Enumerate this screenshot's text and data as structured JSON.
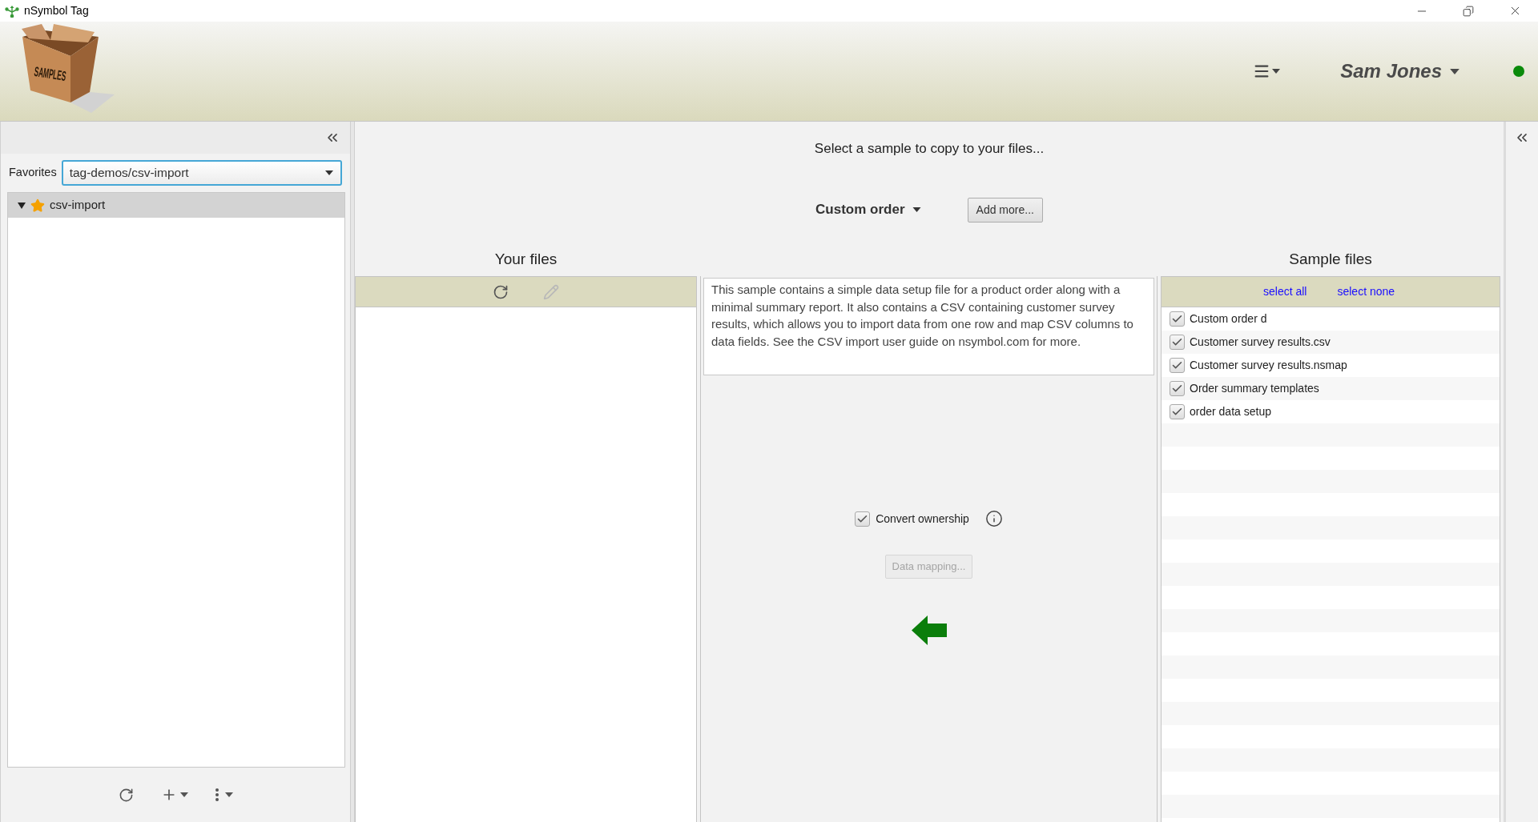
{
  "window": {
    "title": "nSymbol Tag"
  },
  "header": {
    "logo_text": "SAMPLES",
    "user": {
      "name": "Sam Jones",
      "online": true
    }
  },
  "left_panel": {
    "favorites": {
      "label": "Favorites",
      "value": "tag-demos/csv-import",
      "focused": true
    },
    "tree": [
      {
        "label": "csv-import",
        "expanded": true,
        "favorite": true,
        "selected": true
      }
    ]
  },
  "main": {
    "prompt": "Select a sample to copy to your files...",
    "sample_choice": "Custom order",
    "add_button": "Add more...",
    "your_files": {
      "heading": "Your files",
      "tools": [
        {
          "kind": "refresh",
          "disabled": false
        },
        {
          "kind": "edit",
          "disabled": true
        }
      ]
    },
    "description": "This sample contains a simple data setup file for a product order along with a minimal summary report. It also contains a CSV containing customer survey results, which allows you to import data from one row and map CSV columns to data fields. See the CSV import user guide on nsymbol.com for more.",
    "convert_ownership": {
      "label": "Convert ownership",
      "checked": true
    },
    "data_mapping": {
      "label": "Data mapping...",
      "disabled": true
    },
    "sample_files": {
      "heading": "Sample files",
      "links": [
        "select all",
        "select none"
      ],
      "items": [
        {
          "label": "Custom order d",
          "checked": true
        },
        {
          "label": "Customer survey results.csv",
          "checked": true
        },
        {
          "label": "Customer survey results.nsmap",
          "checked": true
        },
        {
          "label": "Order summary templates",
          "checked": true
        },
        {
          "label": "order data setup",
          "checked": true
        }
      ]
    }
  }
}
